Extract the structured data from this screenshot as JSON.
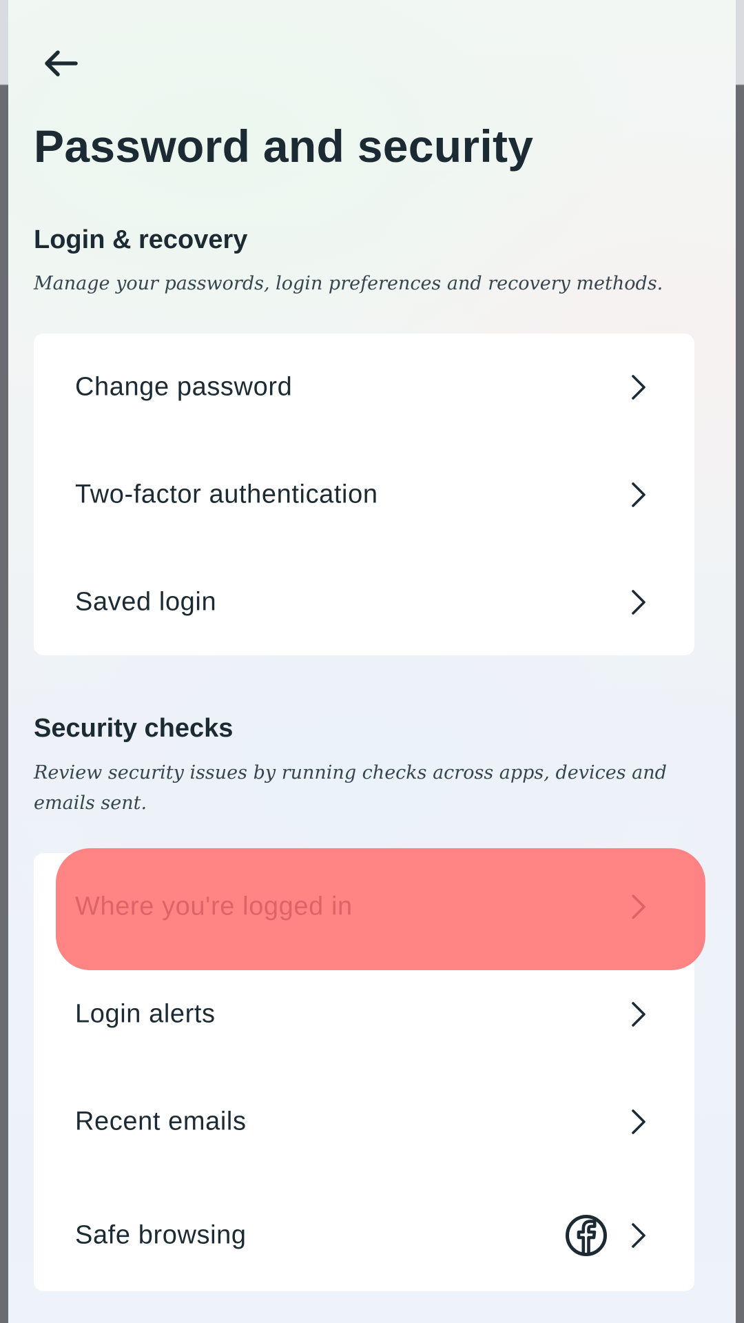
{
  "page": {
    "title": "Password and security"
  },
  "sections": {
    "login_recovery": {
      "title": "Login & recovery",
      "description": "Manage your passwords, login preferences and recovery methods.",
      "items": [
        {
          "label": "Change password"
        },
        {
          "label": "Two-factor authentication"
        },
        {
          "label": "Saved login"
        }
      ]
    },
    "security_checks": {
      "title": "Security checks",
      "description": "Review security issues by running checks across apps, devices and emails sent.",
      "items": [
        {
          "label": "Where you're logged in",
          "highlighted": true
        },
        {
          "label": "Login alerts"
        },
        {
          "label": "Recent emails"
        },
        {
          "label": "Safe browsing",
          "icon": "facebook-icon"
        }
      ]
    }
  },
  "icons": {
    "back": "back-arrow-icon",
    "row_chevron": "chevron-right-icon"
  },
  "colors": {
    "text_primary": "#1c2b33",
    "text_secondary": "#36464f",
    "card_background": "#ffffff",
    "highlight_overlay": "#ff6e6e"
  }
}
